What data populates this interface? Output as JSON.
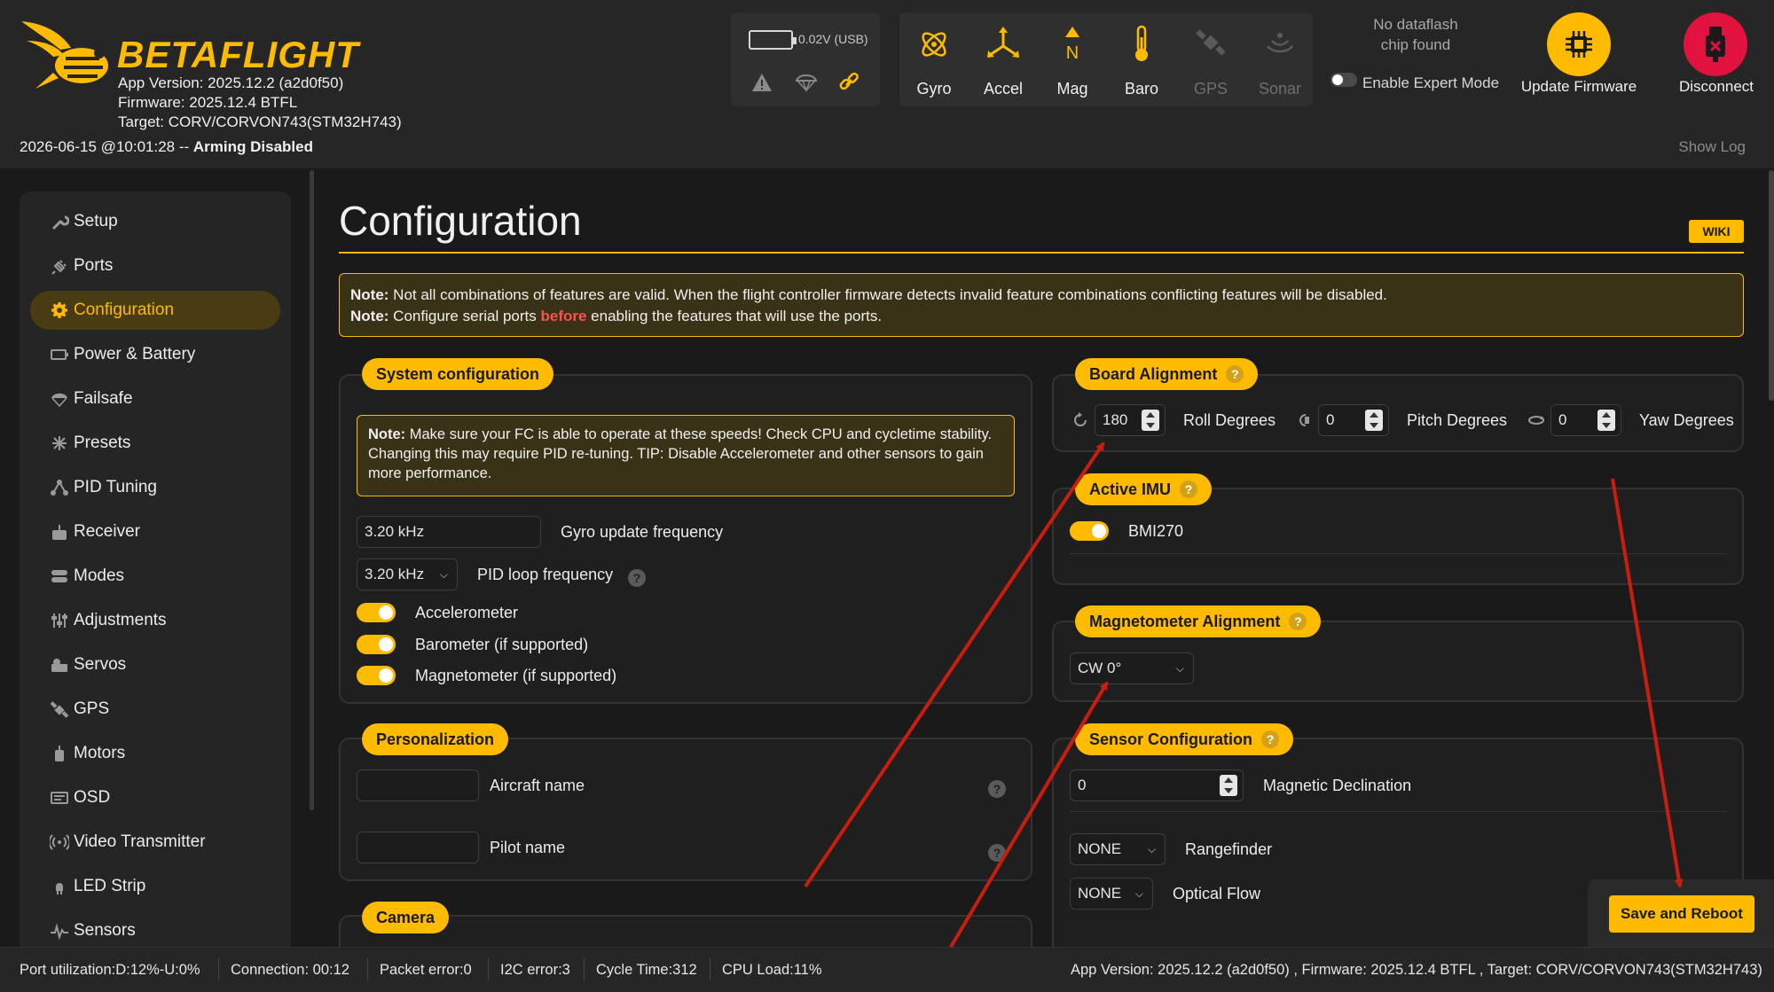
{
  "header": {
    "brand": "BETAFLIGHT",
    "app_version": "App Version: 2025.12.2 (a2d0f50)",
    "firmware": "Firmware: 2025.12.4 BTFL",
    "target": "Target: CORV/CORVON743(STM32H743)",
    "datetime": "2026-06-15 @10:01:28 -- ",
    "arming_status": "Arming Disabled",
    "show_log": "Show Log",
    "battery_text": "0.02V (USB)",
    "sensors": [
      {
        "label": "Gyro",
        "icon": "gyro-icon",
        "active": true
      },
      {
        "label": "Accel",
        "icon": "accel-icon",
        "active": true
      },
      {
        "label": "Mag",
        "icon": "mag-icon",
        "active": true
      },
      {
        "label": "Baro",
        "icon": "baro-icon",
        "active": true
      },
      {
        "label": "GPS",
        "icon": "gps-icon",
        "active": false
      },
      {
        "label": "Sonar",
        "icon": "sonar-icon",
        "active": false
      }
    ],
    "dataflash_line1": "No dataflash",
    "dataflash_line2": "chip found",
    "expert_mode_label": "Enable Expert Mode",
    "update_firmware": "Update Firmware",
    "disconnect": "Disconnect"
  },
  "sidebar": {
    "items": [
      {
        "label": "Setup",
        "icon": "wrench-icon"
      },
      {
        "label": "Ports",
        "icon": "plug-icon"
      },
      {
        "label": "Configuration",
        "icon": "gear-icon",
        "active": true
      },
      {
        "label": "Power & Battery",
        "icon": "battery-icon"
      },
      {
        "label": "Failsafe",
        "icon": "parachute-icon"
      },
      {
        "label": "Presets",
        "icon": "presets-icon"
      },
      {
        "label": "PID Tuning",
        "icon": "pid-icon"
      },
      {
        "label": "Receiver",
        "icon": "receiver-icon"
      },
      {
        "label": "Modes",
        "icon": "modes-icon"
      },
      {
        "label": "Adjustments",
        "icon": "sliders-icon"
      },
      {
        "label": "Servos",
        "icon": "servo-icon"
      },
      {
        "label": "GPS",
        "icon": "satellite-icon"
      },
      {
        "label": "Motors",
        "icon": "motor-icon"
      },
      {
        "label": "OSD",
        "icon": "osd-icon"
      },
      {
        "label": "Video Transmitter",
        "icon": "vtx-icon"
      },
      {
        "label": "LED Strip",
        "icon": "led-icon"
      },
      {
        "label": "Sensors",
        "icon": "sensor-graph-icon"
      }
    ]
  },
  "main": {
    "title": "Configuration",
    "wiki": "WIKI",
    "note1_bold": "Note:",
    "note1_text": " Not all combinations of features are valid. When the flight controller firmware detects invalid feature combinations conflicting features will be disabled.",
    "note2_bold": "Note:",
    "note2_pre": " Configure serial ports ",
    "note2_red": "before",
    "note2_post": " enabling the features that will use the ports.",
    "system": {
      "title": "System configuration",
      "note_bold": "Note:",
      "note_text": " Make sure your FC is able to operate at these speeds! Check CPU and cycletime stability. Changing this may require PID re-tuning. TIP: Disable Accelerometer and other sensors to gain more performance.",
      "gyro_freq_value": "3.20 kHz",
      "gyro_freq_label": "Gyro update frequency",
      "pid_freq_value": "3.20 kHz",
      "pid_freq_label": "PID loop frequency",
      "accelerometer": "Accelerometer",
      "barometer": "Barometer (if supported)",
      "magnetometer": "Magnetometer (if supported)"
    },
    "personalization": {
      "title": "Personalization",
      "aircraft_name_label": "Aircraft name",
      "aircraft_name_value": "",
      "pilot_name_label": "Pilot name",
      "pilot_name_value": ""
    },
    "camera": {
      "title": "Camera"
    },
    "board_alignment": {
      "title": "Board Alignment",
      "roll_value": "180",
      "roll_label": "Roll Degrees",
      "pitch_value": "0",
      "pitch_label": "Pitch Degrees",
      "yaw_value": "0",
      "yaw_label": "Yaw Degrees"
    },
    "active_imu": {
      "title": "Active IMU",
      "imu_name": "BMI270"
    },
    "mag_alignment": {
      "title": "Magnetometer Alignment",
      "value": "CW 0°"
    },
    "sensor_config": {
      "title": "Sensor Configuration",
      "declination_value": "0",
      "declination_label": "Magnetic Declination",
      "rangefinder_value": "NONE",
      "rangefinder_label": "Rangefinder",
      "optical_flow_value": "NONE",
      "optical_flow_label": "Optical Flow"
    },
    "save_reboot": "Save and Reboot",
    "help_mark": "?"
  },
  "statusbar": {
    "port_util": "Port utilization:D:12%-U:0%",
    "connection": "Connection: 00:12",
    "packet_error": "Packet error:0",
    "i2c_error": "I2C error:3",
    "cycle_time": "Cycle Time:312",
    "cpu_load": "CPU Load:11%",
    "version_info": "App Version: 2025.12.2 (a2d0f50) , Firmware: 2025.12.4 BTFL , Target: CORV/CORVON743(STM32H743)"
  },
  "colors": {
    "accent": "#ffbb00",
    "disconnect": "#e2123f",
    "annotation_arrow": "#c81e10"
  }
}
